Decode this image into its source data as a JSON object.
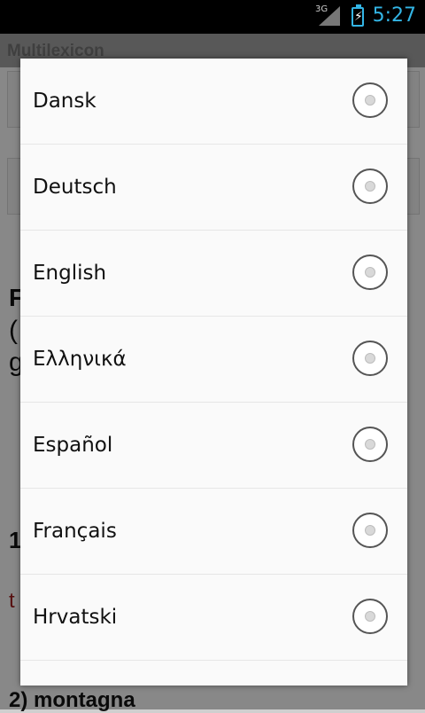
{
  "status_bar": {
    "network": "3G",
    "time": "5:27",
    "icons": [
      "signal-icon",
      "battery-charging-icon"
    ]
  },
  "app": {
    "title": "Multilexicon",
    "peek_lines": [
      "F",
      "(",
      "g",
      "1",
      "t"
    ],
    "entry_heading": "2) montagna"
  },
  "dialog": {
    "options": [
      {
        "label": "Dansk",
        "selected": false
      },
      {
        "label": "Deutsch",
        "selected": false
      },
      {
        "label": "English",
        "selected": false
      },
      {
        "label": "Ελληνικά",
        "selected": false
      },
      {
        "label": "Español",
        "selected": false
      },
      {
        "label": "Français",
        "selected": false
      },
      {
        "label": "Hrvatski",
        "selected": false
      }
    ]
  },
  "colors": {
    "status_accent": "#33b5e5",
    "dialog_background": "#fafafa"
  }
}
